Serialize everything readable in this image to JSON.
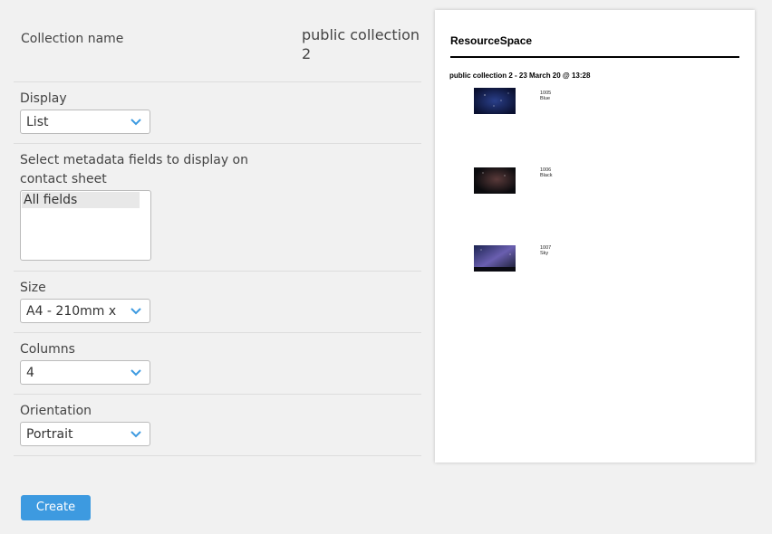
{
  "form": {
    "collection_name_label": "Collection name",
    "collection_name_value": "public collection 2",
    "display_label": "Display",
    "display_value": "List",
    "metadata_label": "Select metadata fields to display on contact sheet",
    "metadata_option": "All fields",
    "size_label": "Size",
    "size_value": "A4 - 210mm x",
    "columns_label": "Columns",
    "columns_value": "4",
    "orientation_label": "Orientation",
    "orientation_value": "Portrait",
    "create_label": "Create"
  },
  "preview": {
    "logo": "ResourceSpace",
    "heading": "public collection 2 - 23 March 20 @ 13:28",
    "items": [
      {
        "id": "1005",
        "title": "Blue"
      },
      {
        "id": "1006",
        "title": "Black"
      },
      {
        "id": "1007",
        "title": "Sky"
      }
    ]
  },
  "colors": {
    "accent": "#3d9ae0",
    "background": "#f1f1f1"
  }
}
